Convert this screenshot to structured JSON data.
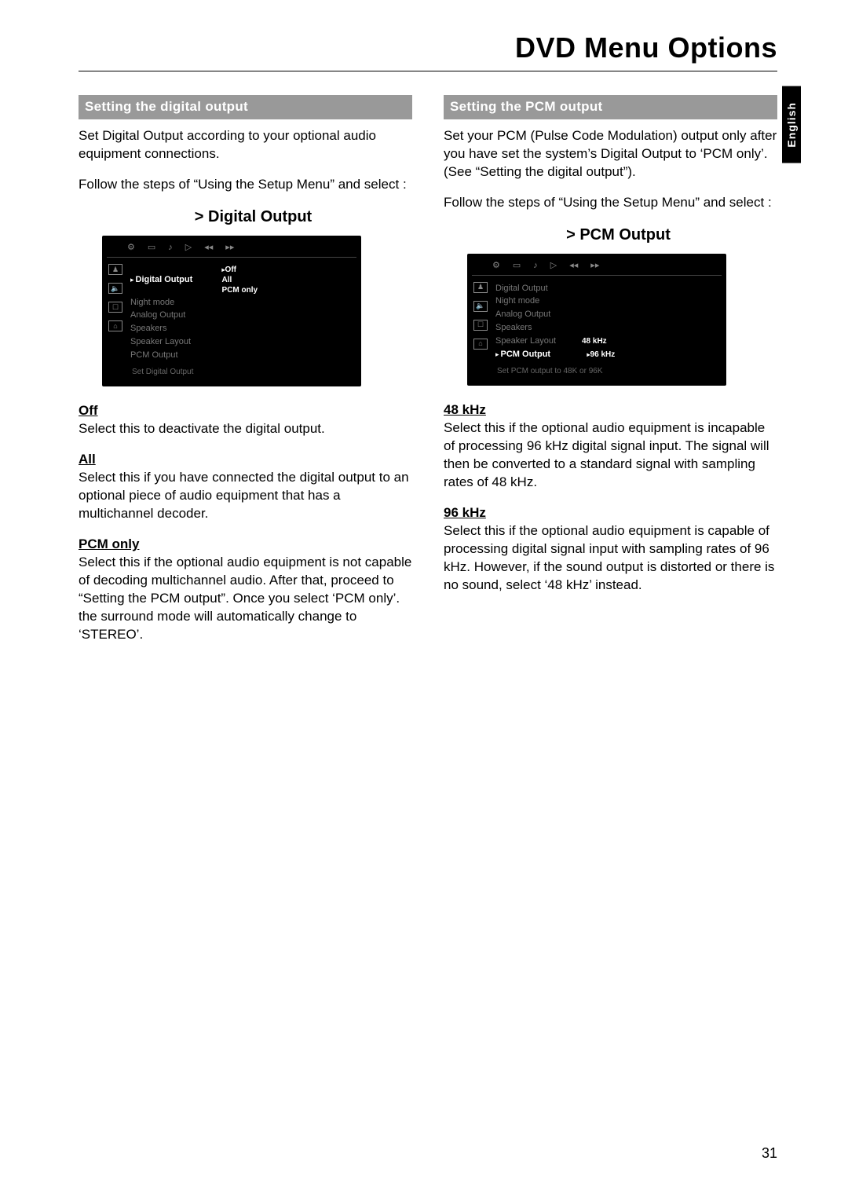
{
  "page_title": "DVD Menu Options",
  "language_tab": "English",
  "page_number": "31",
  "left": {
    "heading": "Setting the digital output",
    "intro": "Set Digital Output according to your optional audio equipment connections.",
    "follow": "Follow the steps of “Using the Setup Menu” and select :",
    "ss_title": "> Digital Output",
    "osd": {
      "menu": [
        "Digital Output",
        "Night mode",
        "Analog Output",
        "Speakers",
        "Speaker Layout",
        "PCM Output"
      ],
      "selected_index": 0,
      "options": [
        "Off",
        "All",
        "PCM only"
      ],
      "status": "Set Digital Output"
    },
    "opts": [
      {
        "h": "Off",
        "t": "Select this to deactivate the digital output."
      },
      {
        "h": "All",
        "t": "Select this if you have connected the digital output to an optional piece of audio equipment that has a multichannel decoder."
      },
      {
        "h": "PCM only",
        "t": "Select this if the optional audio equipment is not capable of decoding multichannel audio. After that, proceed to “Setting the PCM output”.  Once you select ‘PCM only’. the surround mode will automatically change to ‘STEREO’."
      }
    ]
  },
  "right": {
    "heading": "Setting the PCM output",
    "intro": "Set your PCM (Pulse Code Modulation) output only after you have set the system’s Digital Output to ‘PCM only’.  (See “Setting the digital output”).",
    "follow": "Follow the steps of “Using the Setup Menu” and select :",
    "ss_title": "> PCM Output",
    "osd": {
      "menu": [
        "Digital Output",
        "Night mode",
        "Analog Output",
        "Speakers",
        "Speaker Layout",
        "PCM Output"
      ],
      "selected_index": 5,
      "options": [
        "48 kHz",
        "96 kHz"
      ],
      "status": "Set PCM output to 48K or 96K"
    },
    "opts": [
      {
        "h": "48 kHz",
        "t": "Select this if the optional audio equipment is incapable of processing 96 kHz digital signal input.  The signal will then be converted to a standard signal with sampling rates of 48 kHz."
      },
      {
        "h": "96 kHz",
        "t": "Select this if the optional audio equipment is capable of processing digital signal input with sampling rates of 96 kHz.  However, if the sound output is distorted or there is no sound, select ‘48 kHz’ instead."
      }
    ]
  }
}
